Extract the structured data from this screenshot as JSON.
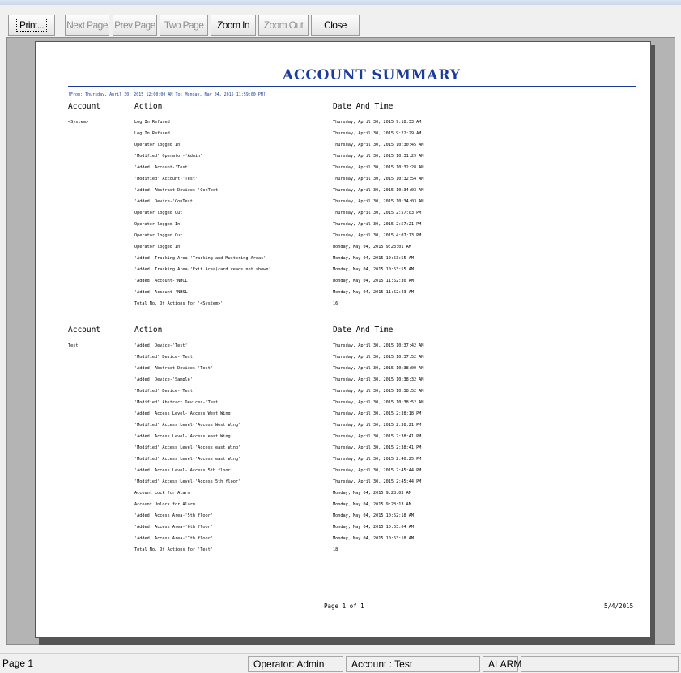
{
  "toolbar": {
    "buttons": [
      {
        "label": "Print...",
        "enabled": true
      },
      {
        "label": "Next Page",
        "enabled": false
      },
      {
        "label": "Prev Page",
        "enabled": false
      },
      {
        "label": "Two Page",
        "enabled": false
      },
      {
        "label": "Zoom In",
        "enabled": true
      },
      {
        "label": "Zoom Out",
        "enabled": false
      },
      {
        "label": "Close",
        "enabled": true
      }
    ]
  },
  "report": {
    "title": "ACCOUNT SUMMARY",
    "date_range": "[From: Thursday, April 30, 2015 12:00:00 AM   To: Monday, May 04, 2015 11:59:00 PM]",
    "headers": {
      "account": "Account",
      "action": "Action",
      "date": "Date And Time"
    },
    "sections": [
      {
        "account": "<System>",
        "rows": [
          {
            "action": "Log In Refused",
            "date": "Thursday, April 30, 2015 9:18:33 AM"
          },
          {
            "action": "Log In Refused",
            "date": "Thursday, April 30, 2015 9:22:29 AM"
          },
          {
            "action": "Operator logged In",
            "date": "Thursday, April 30, 2015 10:30:45 AM"
          },
          {
            "action": "'Modified' Operator-'Admin'",
            "date": "Thursday, April 30, 2015 10:31:29 AM"
          },
          {
            "action": "'Added' Account-'Test'",
            "date": "Thursday, April 30, 2015 10:32:28 AM"
          },
          {
            "action": "'Modified' Account-'Test'",
            "date": "Thursday, April 30, 2015 10:32:54 AM"
          },
          {
            "action": "'Added' Abstract Devices-'ConTest'",
            "date": "Thursday, April 30, 2015 10:34:03 AM"
          },
          {
            "action": "'Added' Device-'ConTest'",
            "date": "Thursday, April 30, 2015 10:34:03 AM"
          },
          {
            "action": "Operator logged Out",
            "date": "Thursday, April 30, 2015 2:57:03 PM"
          },
          {
            "action": "Operator logged In",
            "date": "Thursday, April 30, 2015 2:57:21 PM"
          },
          {
            "action": "Operator logged Out",
            "date": "Thursday, April 30, 2015 4:07:13 PM"
          },
          {
            "action": "Operator logged In",
            "date": "Monday, May 04, 2015 9:23:01 AM"
          },
          {
            "action": "'Added' Tracking Area-'Tracking and Mustering Areas'",
            "date": "Monday, May 04, 2015 10:53:55 AM"
          },
          {
            "action": "'Added' Tracking Area-'Exit Area(card reads not shown'",
            "date": "Monday, May 04, 2015 10:53:55 AM"
          },
          {
            "action": "'Added' Account-'NHCL'",
            "date": "Monday, May 04, 2015 11:52:30 AM"
          },
          {
            "action": "'Added' Account-'NHSL'",
            "date": "Monday, May 04, 2015 11:52:43 AM"
          }
        ],
        "total_label": "Total No. Of Actions For '<System>'",
        "total": "16"
      },
      {
        "account": "Test",
        "rows": [
          {
            "action": "'Added' Device-'Test'",
            "date": "Thursday, April 30, 2015 10:37:42 AM"
          },
          {
            "action": "'Modified' Device-'Test'",
            "date": "Thursday, April 30, 2015 10:37:52 AM"
          },
          {
            "action": "'Added' Abstract Devices-'Test'",
            "date": "Thursday, April 30, 2015 10:38:00 AM"
          },
          {
            "action": "'Added' Device-'Sample'",
            "date": "Thursday, April 30, 2015 10:38:32 AM"
          },
          {
            "action": "'Modified' Device-'Test'",
            "date": "Thursday, April 30, 2015 10:38:52 AM"
          },
          {
            "action": "'Modified' Abstract Devices-'Test'",
            "date": "Thursday, April 30, 2015 10:38:52 AM"
          },
          {
            "action": "'Added' Access Level-'Access West Wing'",
            "date": "Thursday, April 30, 2015 2:38:18 PM"
          },
          {
            "action": "'Modified' Access Level-'Access West Wing'",
            "date": "Thursday, April 30, 2015 2:38:21 PM"
          },
          {
            "action": "'Added' Access Level-'Access east Wing'",
            "date": "Thursday, April 30, 2015 2:38:41 PM"
          },
          {
            "action": "'Modified' Access Level-'Access east Wing'",
            "date": "Thursday, April 30, 2015 2:38:41 PM"
          },
          {
            "action": "'Modified' Access Level-'Access east Wing'",
            "date": "Thursday, April 30, 2015 2:40:25 PM"
          },
          {
            "action": "'Added' Access Level-'Access 5th floor'",
            "date": "Thursday, April 30, 2015 2:45:44 PM"
          },
          {
            "action": "'Modified' Access Level-'Access 5th floor'",
            "date": "Thursday, April 30, 2015 2:45:44 PM"
          },
          {
            "action": "Account Lock for Alarm",
            "date": "Monday, May 04, 2015 9:28:03 AM"
          },
          {
            "action": "Account Unlock for Alarm",
            "date": "Monday, May 04, 2015 9:28:13 AM"
          },
          {
            "action": "'Added' Access Area-'5th floor'",
            "date": "Monday, May 04, 2015 10:52:18 AM"
          },
          {
            "action": "'Added' Access Area-'6th floor'",
            "date": "Monday, May 04, 2015 10:53:04 AM"
          },
          {
            "action": "'Added' Access Area-'7th floor'",
            "date": "Monday, May 04, 2015 10:53:18 AM"
          }
        ],
        "total_label": "Total No. Of Actions For 'Test'",
        "total": "18"
      }
    ],
    "page_label": "Page 1 of 1",
    "print_date": "5/4/2015"
  },
  "status_bar": {
    "page": "Page 1",
    "operator": "Operator: Admin",
    "account": "Account : Test",
    "alarm": "ALARM"
  }
}
